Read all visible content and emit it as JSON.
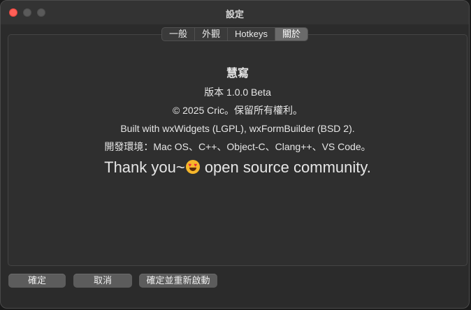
{
  "window": {
    "title": "設定"
  },
  "tabs": [
    {
      "label": "一般",
      "active": false
    },
    {
      "label": "外觀",
      "active": false
    },
    {
      "label": "Hotkeys",
      "active": false
    },
    {
      "label": "關於",
      "active": true
    }
  ],
  "about": {
    "app_name": "慧寫",
    "version": "版本 1.0.0 Beta",
    "copyright": "© 2025 Cric。保留所有權利。",
    "built_with": "Built with wxWidgets (LGPL), wxFormBuilder (BSD 2).",
    "dev_env": "開發環境：Mac OS、C++、Object-C、Clang++、VS Code。",
    "thanks_prefix": "Thank you~",
    "thanks_emoji": "smiling-face-with-heart-eyes",
    "thanks_suffix": " open source community."
  },
  "buttons": {
    "ok": "確定",
    "cancel": "取消",
    "ok_restart": "確定並重新啟動"
  },
  "colors": {
    "close": "#ff5f57",
    "active_tab": "#6a6a6a",
    "button": "#5c5c5c"
  }
}
